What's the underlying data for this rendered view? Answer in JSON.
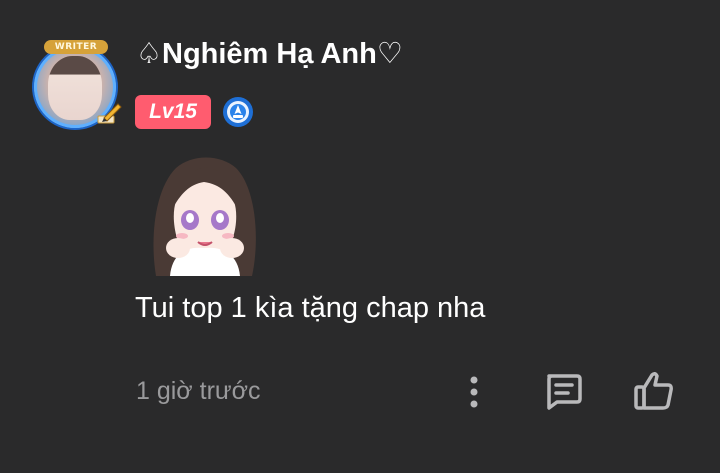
{
  "comment": {
    "author": {
      "name": "♤Nghiêm Hạ Anh♡",
      "avatar_badge": "WRITER",
      "level": "Lv15",
      "level_color": "#ff5c6f",
      "rank_icon": "blue-rank-icon"
    },
    "sticker": "anime-girl-sticker",
    "text": "Tui top 1 kìa tặng chap nha",
    "timestamp": "1 giờ trước",
    "actions": {
      "more": "more-options-icon",
      "reply": "reply-icon",
      "like": "thumbs-up-icon"
    }
  },
  "colors": {
    "background": "#2a2a2b",
    "text": "#ffffff",
    "muted": "#9a9a9c"
  }
}
